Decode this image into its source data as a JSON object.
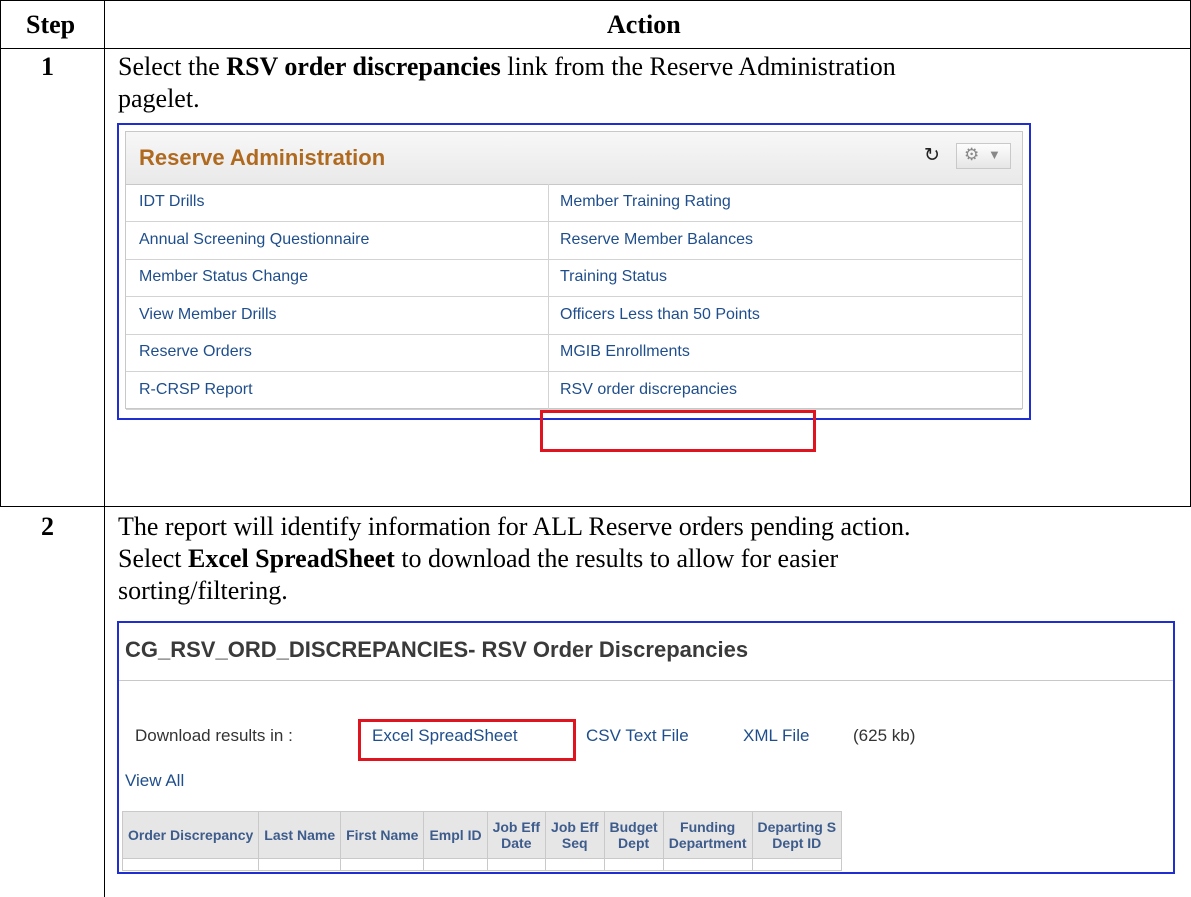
{
  "table": {
    "header_step": "Step",
    "header_action": "Action"
  },
  "steps": [
    {
      "number": "1",
      "line1_pre": "Select the ",
      "line1_bold": "RSV order discrepancies",
      "line1_post": " link from the Reserve Administration",
      "line2": "pagelet."
    },
    {
      "number": "2",
      "line1": "The report will identify information for ALL Reserve orders pending action.",
      "line2_pre": "Select ",
      "line2_bold": "Excel SpreadSheet",
      "line2_post": " to download the results to allow for easier",
      "line3": "sorting/filtering."
    }
  ],
  "pagelet": {
    "title": "Reserve Administration",
    "refresh_icon": "refresh-icon",
    "gear_icon": "gear-icon",
    "links": [
      [
        "IDT Drills",
        "Member Training Rating"
      ],
      [
        "Annual Screening Questionnaire",
        "Reserve Member Balances"
      ],
      [
        "Member Status Change",
        "Training Status"
      ],
      [
        "View Member Drills",
        "Officers Less than 50 Points"
      ],
      [
        "Reserve Orders",
        "MGIB Enrollments"
      ],
      [
        "R-CRSP Report",
        "RSV order discrepancies"
      ]
    ]
  },
  "report": {
    "title": "CG_RSV_ORD_DISCREPANCIES- RSV Order Discrepancies",
    "download_label": "Download results in :",
    "excel_link": "Excel SpreadSheet",
    "csv_link": "CSV Text File",
    "xml_link": "XML File",
    "size": "(625 kb)",
    "view_all": "View All",
    "columns": [
      [
        "Order Discrepancy"
      ],
      [
        "Last Name"
      ],
      [
        "First Name"
      ],
      [
        "Empl ID"
      ],
      [
        "Job Eff",
        "Date"
      ],
      [
        "Job Eff",
        "Seq"
      ],
      [
        "Budget",
        "Dept"
      ],
      [
        "Funding",
        "Department"
      ],
      [
        "Departing S",
        "Dept ID"
      ]
    ]
  },
  "colors": {
    "frame_blue": "#1f2ed0",
    "highlight_red": "#e0141e",
    "pagelet_title": "#b06a1f",
    "link": "#1f4e8c"
  }
}
